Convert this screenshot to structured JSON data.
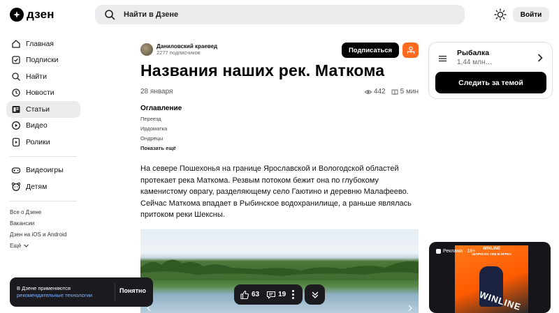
{
  "header": {
    "logo_text": "дзен",
    "search_placeholder": "Найти в Дзене",
    "login_label": "Войти"
  },
  "sidebar": {
    "items": [
      {
        "label": "Главная",
        "icon": "home-icon"
      },
      {
        "label": "Подписки",
        "icon": "subscriptions-icon"
      },
      {
        "label": "Найти",
        "icon": "search-icon"
      },
      {
        "label": "Новости",
        "icon": "news-icon"
      },
      {
        "label": "Статьи",
        "icon": "articles-icon",
        "active": true
      },
      {
        "label": "Видео",
        "icon": "video-icon"
      },
      {
        "label": "Ролики",
        "icon": "shorts-icon"
      }
    ],
    "extra_items": [
      {
        "label": "Видеоигры",
        "icon": "gamepad-icon"
      },
      {
        "label": "Детям",
        "icon": "kids-icon"
      }
    ],
    "footer_links": [
      "Все о Дзене",
      "Вакансии",
      "Дзен на iOS и Android",
      "Ещё"
    ]
  },
  "article": {
    "author_name": "Даниловский краевед",
    "author_subscribers": "2277 подписчиков",
    "subscribe_label": "Подписаться",
    "title": "Названия наших рек. Маткома",
    "date": "28 января",
    "views": "442",
    "read_time": "5 мин",
    "toc_title": "Оглавление",
    "toc_items": [
      "Переезд",
      "Ирдоматка",
      "Ондрецы"
    ],
    "toc_more": "Показать ещё",
    "body": "На севере Пошехонья на границе Ярославской и Вологодской областей протекает река Маткома. Резвым потоком бежит она по глубокому каменистому оврагу, разделяющему село Гаютино и деревню Малафеево. Сейчас Маткома впадает в Рыбинское водохранилище, а раньше являлась притоком реки Шексны."
  },
  "actions": {
    "likes": "63",
    "comments": "19"
  },
  "topic": {
    "name": "Рыбалка",
    "count": "1,44 млн…",
    "follow_label": "Следить за темой"
  },
  "ad": {
    "label": "Реклама · 18+",
    "brand": "WINLINE",
    "promo": "«БОРИСКО УЖЕ В ИГРЕ!»",
    "word": "WINLINE"
  },
  "cookie": {
    "text": "В Дзене применяются",
    "link": "рекомендательные технологии",
    "button": "Понятно"
  },
  "colors": {
    "accent_orange": "#ff6a1f",
    "dark": "#1b1b1f",
    "link_blue": "#7fb2ff"
  }
}
